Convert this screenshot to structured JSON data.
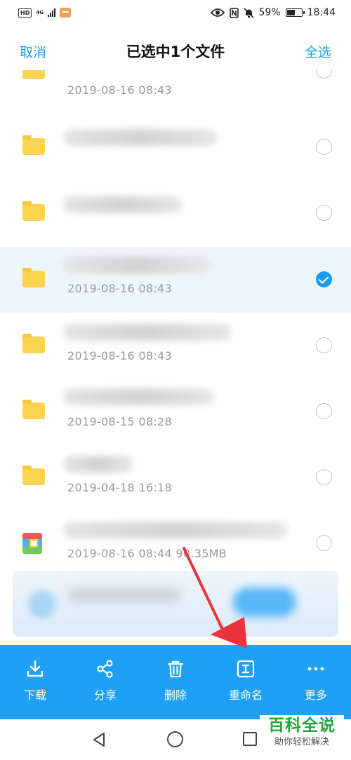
{
  "status_bar": {
    "hd_label": "HD",
    "network_label": "4G",
    "battery_text": "59%",
    "battery_level": 0.59,
    "time": "18:44"
  },
  "header": {
    "cancel_label": "取消",
    "title": "已选中1个文件",
    "select_all_label": "全选"
  },
  "files": [
    {
      "icon": "folder-icon",
      "meta": "2019-08-16  08:43",
      "selected": false
    },
    {
      "icon": "folder-icon",
      "meta": "",
      "selected": false
    },
    {
      "icon": "folder-icon",
      "meta": "",
      "selected": false
    },
    {
      "icon": "folder-icon",
      "meta": "2019-08-16  08:43",
      "selected": true
    },
    {
      "icon": "folder-icon",
      "meta": "2019-08-16  08:43",
      "selected": false
    },
    {
      "icon": "folder-icon",
      "meta": "2019-08-15  08:28",
      "selected": false
    },
    {
      "icon": "folder-icon",
      "meta": "2019-04-18  16:18",
      "selected": false
    },
    {
      "icon": "archive-icon",
      "meta": "2019-08-16  08:44   90.35MB",
      "selected": false
    }
  ],
  "actions": [
    {
      "id": "download",
      "icon": "download-icon",
      "label": "下载"
    },
    {
      "id": "share",
      "icon": "share-icon",
      "label": "分享"
    },
    {
      "id": "delete",
      "icon": "trash-icon",
      "label": "删除"
    },
    {
      "id": "rename",
      "icon": "rename-icon",
      "label": "重命名"
    },
    {
      "id": "more",
      "icon": "more-icon",
      "label": "更多"
    }
  ],
  "watermark": {
    "title": "百科全说",
    "subtitle": "助你轻松解决"
  },
  "colors": {
    "accent": "#1a9df0",
    "action_bar": "#1ea1f5",
    "folder": "#fbd454",
    "arrow": "#e8343a",
    "watermark_green": "#23a53a"
  }
}
